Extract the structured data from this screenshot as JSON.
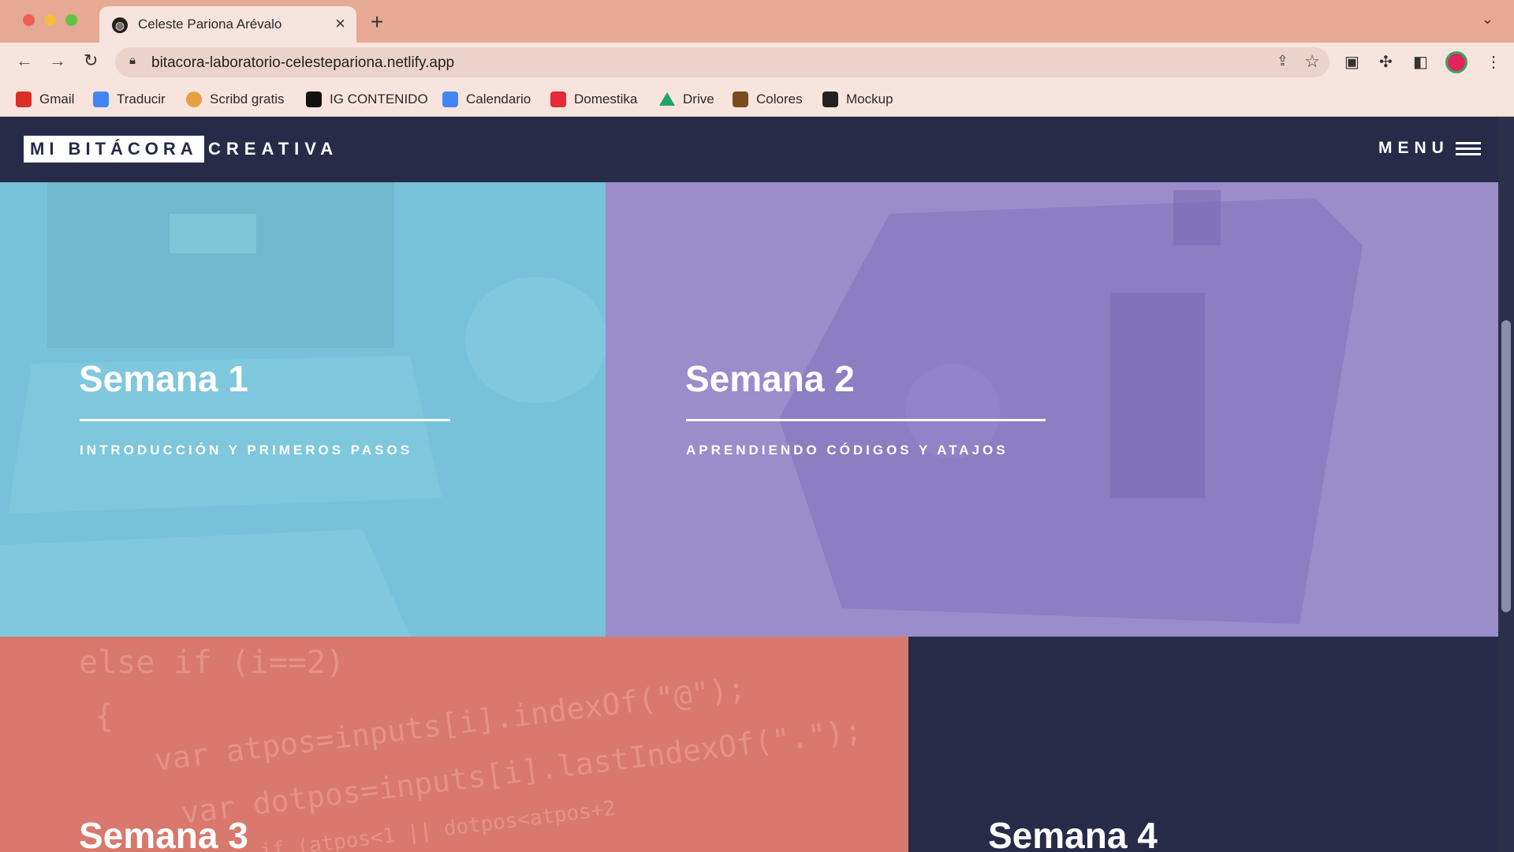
{
  "browser": {
    "tab_title": "Celeste Pariona Arévalo",
    "url": "bitacora-laboratorio-celestepariona.netlify.app",
    "bookmarks": [
      {
        "label": "Gmail",
        "icon": "gmail-icon",
        "color": "#d93025"
      },
      {
        "label": "Traducir",
        "icon": "translate-icon",
        "color": "#4285f4"
      },
      {
        "label": "Scribd gratis",
        "icon": "scribd-icon",
        "color": "#e6a042"
      },
      {
        "label": "IG CONTENIDO",
        "icon": "instagram-icon",
        "color": "#111111"
      },
      {
        "label": "Calendario",
        "icon": "calendar-icon",
        "color": "#4285f4"
      },
      {
        "label": "Domestika",
        "icon": "domestika-icon",
        "color": "#e5283a"
      },
      {
        "label": "Drive",
        "icon": "drive-icon",
        "color": "#1fa463"
      },
      {
        "label": "Colores",
        "icon": "colores-icon",
        "color": "#7a4b1d"
      },
      {
        "label": "Mockup",
        "icon": "mockup-icon",
        "color": "#222222"
      }
    ]
  },
  "site": {
    "logo_box": "MI BITÁCORA",
    "logo_text": "CREATIVA",
    "menu_label": "MENU"
  },
  "cards": [
    {
      "title": "Semana 1",
      "subtitle": "INTRODUCCIÓN Y PRIMEROS PASOS",
      "color": "#77c2da"
    },
    {
      "title": "Semana 2",
      "subtitle": "APRENDIENDO CÓDIGOS Y ATAJOS",
      "color": "#9a8dca"
    },
    {
      "title": "Semana 3",
      "color": "#d9786c"
    },
    {
      "title": "Semana 4",
      "color": "#272b48"
    }
  ],
  "code_lines": [
    "else if (i==2)",
    "{",
    "var atpos=inputs[i].indexOf(\"@\");",
    "var dotpos=inputs[i].lastIndexOf(\".\");",
    "if (atpos<1 || dotpos<atpos+2"
  ]
}
